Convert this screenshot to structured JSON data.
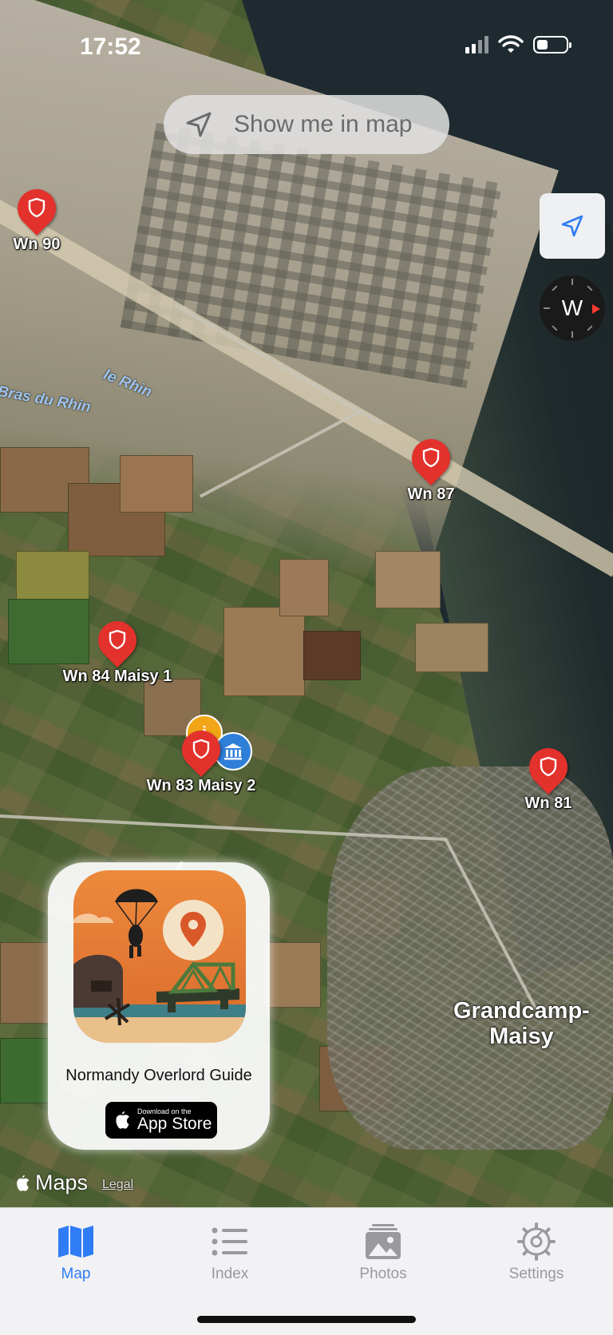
{
  "status_bar": {
    "time": "17:52"
  },
  "map": {
    "show_me_button": "Show me in map",
    "compass_heading": "W",
    "water_labels": [
      "le Rhin",
      "Bras du Rhin"
    ],
    "place_label": "Grandcamp-\nMaisy",
    "pins": [
      {
        "label": "Wn 90"
      },
      {
        "label": "Wn 87"
      },
      {
        "label": "Wn 84 Maisy 1"
      },
      {
        "label": "Wn 83 Maisy 2"
      },
      {
        "label": "Wn 81"
      }
    ],
    "info_pin_symbol": "i",
    "maps_attribution": "Maps",
    "legal_link": "Legal"
  },
  "promo": {
    "title": "Normandy Overlord Guide",
    "badge_small": "Download on the",
    "badge_big": "App Store"
  },
  "tabbar": {
    "tabs": [
      {
        "label": "Map",
        "icon": "map-icon",
        "active": true
      },
      {
        "label": "Index",
        "icon": "list-icon",
        "active": false
      },
      {
        "label": "Photos",
        "icon": "photos-icon",
        "active": false
      },
      {
        "label": "Settings",
        "icon": "gear-icon",
        "active": false
      }
    ]
  },
  "colors": {
    "accent": "#2f7cf6",
    "pin_red": "#e3312c",
    "info_orange": "#f2a516",
    "museum_blue": "#2f7fd8"
  }
}
